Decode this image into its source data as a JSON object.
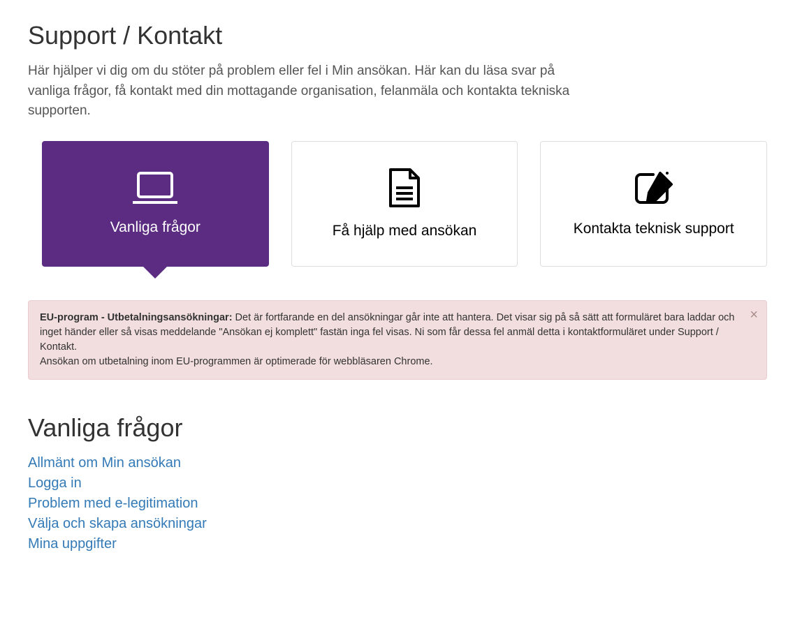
{
  "header": {
    "title": "Support / Kontakt",
    "intro": "Här hjälper vi dig om du stöter på problem eller fel i Min ansökan. Här kan du läsa svar på vanliga frågor, få kontakt med din mottagande organisation, felanmäla och kontakta tekniska supporten."
  },
  "tabs": [
    {
      "label": "Vanliga frågor",
      "icon": "laptop-icon",
      "active": true
    },
    {
      "label": "Få hjälp med ansökan",
      "icon": "document-icon",
      "active": false
    },
    {
      "label": "Kontakta teknisk support",
      "icon": "edit-icon",
      "active": false
    }
  ],
  "alert": {
    "bold": "EU-program - Utbetalningsansökningar:",
    "body": " Det är fortfarande en del ansökningar går inte att hantera. Det visar sig på så sätt att formuläret bara laddar och inget händer eller så visas meddelande \"Ansökan ej komplett\" fastän inga fel visas. Ni som får dessa fel anmäl detta i kontaktformuläret under Support / Kontakt.",
    "body2": "Ansökan om utbetalning inom EU-programmen är optimerade för webbläsaren Chrome.",
    "close": "×"
  },
  "faq": {
    "title": "Vanliga frågor",
    "links": [
      "Allmänt om Min ansökan",
      "Logga in",
      "Problem med e-legitimation",
      "Välja och skapa ansökningar",
      "Mina uppgifter"
    ]
  }
}
